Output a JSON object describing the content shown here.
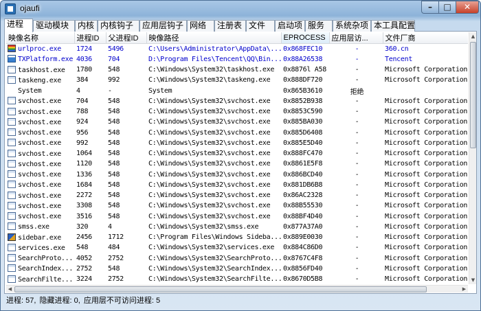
{
  "window": {
    "title": "ojaufi"
  },
  "controls": {
    "minimize": "–",
    "maximize": "□",
    "close": "✕"
  },
  "tabs": [
    {
      "label": "进程",
      "active": true
    },
    {
      "label": "驱动模块"
    },
    {
      "label": "内核"
    },
    {
      "label": "内核钩子"
    },
    {
      "label": "应用层钩子"
    },
    {
      "label": "网络"
    },
    {
      "label": "注册表"
    },
    {
      "label": "文件"
    },
    {
      "label": "启动项"
    },
    {
      "label": "服务"
    },
    {
      "label": "系统杂项"
    },
    {
      "label": "本工具配置"
    }
  ],
  "table": {
    "headers": [
      "映像名称",
      "进程ID",
      "父进程ID",
      "映像路径",
      "EPROCESS",
      "应用层访...",
      "文件厂商"
    ],
    "rows": [
      {
        "icon": "rainbow-app-icon",
        "highlight": true,
        "name": "urlproc.exe",
        "pid": "1724",
        "ppid": "5496",
        "path": "C:\\Users\\Administrator\\AppData\\...",
        "eprocess": "0x868FEC10",
        "access": "-",
        "vendor": "360.cn"
      },
      {
        "icon": "qq-app-icon",
        "highlight": true,
        "name": "TXPlatform.exe",
        "pid": "4036",
        "ppid": "704",
        "path": "D:\\Program Files\\Tencent\\QQ\\Bin...",
        "eprocess": "0x88A26538",
        "access": "-",
        "vendor": "Tencent"
      },
      {
        "icon": "window-icon",
        "name": "taskhost.exe",
        "pid": "1780",
        "ppid": "548",
        "path": "C:\\Windows\\System32\\taskhost.exe",
        "eprocess": "0x8876l A58",
        "access": "-",
        "vendor": "Microsoft Corporation"
      },
      {
        "icon": "window-icon",
        "name": "taskeng.exe",
        "pid": "384",
        "ppid": "992",
        "path": "C:\\Windows\\System32\\taskeng.exe",
        "eprocess": "0x888DF720",
        "access": "-",
        "vendor": "Microsoft Corporation"
      },
      {
        "icon": "system-icon",
        "name": "System",
        "pid": "4",
        "ppid": "-",
        "path": "System",
        "eprocess": "0x865B3610",
        "access": "拒绝",
        "vendor": ""
      },
      {
        "icon": "window-icon",
        "name": "svchost.exe",
        "pid": "704",
        "ppid": "548",
        "path": "C:\\Windows\\System32\\svchost.exe",
        "eprocess": "0x8852B938",
        "access": "-",
        "vendor": "Microsoft Corporation"
      },
      {
        "icon": "window-icon",
        "name": "svchost.exe",
        "pid": "788",
        "ppid": "548",
        "path": "C:\\Windows\\System32\\svchost.exe",
        "eprocess": "0x8853C590",
        "access": "-",
        "vendor": "Microsoft Corporation"
      },
      {
        "icon": "window-icon",
        "name": "svchost.exe",
        "pid": "924",
        "ppid": "548",
        "path": "C:\\Windows\\System32\\svchost.exe",
        "eprocess": "0x885BA030",
        "access": "-",
        "vendor": "Microsoft Corporation"
      },
      {
        "icon": "window-icon",
        "name": "svchost.exe",
        "pid": "956",
        "ppid": "548",
        "path": "C:\\Windows\\System32\\svchost.exe",
        "eprocess": "0x885D6408",
        "access": "-",
        "vendor": "Microsoft Corporation"
      },
      {
        "icon": "window-icon",
        "name": "svchost.exe",
        "pid": "992",
        "ppid": "548",
        "path": "C:\\Windows\\System32\\svchost.exe",
        "eprocess": "0x885E5D40",
        "access": "-",
        "vendor": "Microsoft Corporation"
      },
      {
        "icon": "window-icon",
        "name": "svchost.exe",
        "pid": "1064",
        "ppid": "548",
        "path": "C:\\Windows\\System32\\svchost.exe",
        "eprocess": "0x888FC470",
        "access": "-",
        "vendor": "Microsoft Corporation"
      },
      {
        "icon": "window-icon",
        "name": "svchost.exe",
        "pid": "1120",
        "ppid": "548",
        "path": "C:\\Windows\\System32\\svchost.exe",
        "eprocess": "0x8861E5F8",
        "access": "-",
        "vendor": "Microsoft Corporation"
      },
      {
        "icon": "window-icon",
        "name": "svchost.exe",
        "pid": "1336",
        "ppid": "548",
        "path": "C:\\Windows\\System32\\svchost.exe",
        "eprocess": "0x886BCD40",
        "access": "-",
        "vendor": "Microsoft Corporation"
      },
      {
        "icon": "window-icon",
        "name": "svchost.exe",
        "pid": "1684",
        "ppid": "548",
        "path": "C:\\Windows\\System32\\svchost.exe",
        "eprocess": "0x881DB6B8",
        "access": "-",
        "vendor": "Microsoft Corporation"
      },
      {
        "icon": "window-icon",
        "name": "svchost.exe",
        "pid": "2272",
        "ppid": "548",
        "path": "C:\\Windows\\System32\\svchost.exe",
        "eprocess": "0x86AC2328",
        "access": "-",
        "vendor": "Microsoft Corporation"
      },
      {
        "icon": "window-icon",
        "name": "svchost.exe",
        "pid": "3308",
        "ppid": "548",
        "path": "C:\\Windows\\System32\\svchost.exe",
        "eprocess": "0x88B55530",
        "access": "-",
        "vendor": "Microsoft Corporation"
      },
      {
        "icon": "window-icon",
        "name": "svchost.exe",
        "pid": "3516",
        "ppid": "548",
        "path": "C:\\Windows\\System32\\svchost.exe",
        "eprocess": "0x88BF4D40",
        "access": "-",
        "vendor": "Microsoft Corporation"
      },
      {
        "icon": "window-icon",
        "name": "smss.exe",
        "pid": "320",
        "ppid": "4",
        "path": "C:\\Windows\\System32\\smss.exe",
        "eprocess": "0x877A37A0",
        "access": "-",
        "vendor": "Microsoft Corporation"
      },
      {
        "icon": "sidebar-app-icon",
        "name": "sidebar.exe",
        "pid": "2456",
        "ppid": "1712",
        "path": "C:\\Program Files\\Windows Sideba...",
        "eprocess": "0x889E0030",
        "access": "-",
        "vendor": "Microsoft Corporation"
      },
      {
        "icon": "window-icon",
        "name": "services.exe",
        "pid": "548",
        "ppid": "484",
        "path": "C:\\Windows\\System32\\services.exe",
        "eprocess": "0x884C86D0",
        "access": "-",
        "vendor": "Microsoft Corporation"
      },
      {
        "icon": "window-icon",
        "name": "SearchProto...",
        "pid": "4052",
        "ppid": "2752",
        "path": "C:\\Windows\\System32\\SearchProto...",
        "eprocess": "0x8767C4F8",
        "access": "-",
        "vendor": "Microsoft Corporation"
      },
      {
        "icon": "window-icon",
        "name": "SearchIndex...",
        "pid": "2752",
        "ppid": "548",
        "path": "C:\\Windows\\System32\\SearchIndex...",
        "eprocess": "0x8856FD40",
        "access": "-",
        "vendor": "Microsoft Corporation"
      },
      {
        "icon": "window-icon",
        "name": "SearchFilte...",
        "pid": "3224",
        "ppid": "2752",
        "path": "C:\\Windows\\System32\\SearchFilte...",
        "eprocess": "0x8670D5B8",
        "access": "-",
        "vendor": "Microsoft Corporation"
      }
    ]
  },
  "status": {
    "processes": "进程: 57,",
    "hidden": "隐藏进程: 0,",
    "inaccessible": "应用层不可访问进程: 5"
  },
  "colors": {
    "highlight_text": "#0000cc",
    "title_grad_top": "#a9c7e6",
    "close_red": "#c7412a"
  }
}
